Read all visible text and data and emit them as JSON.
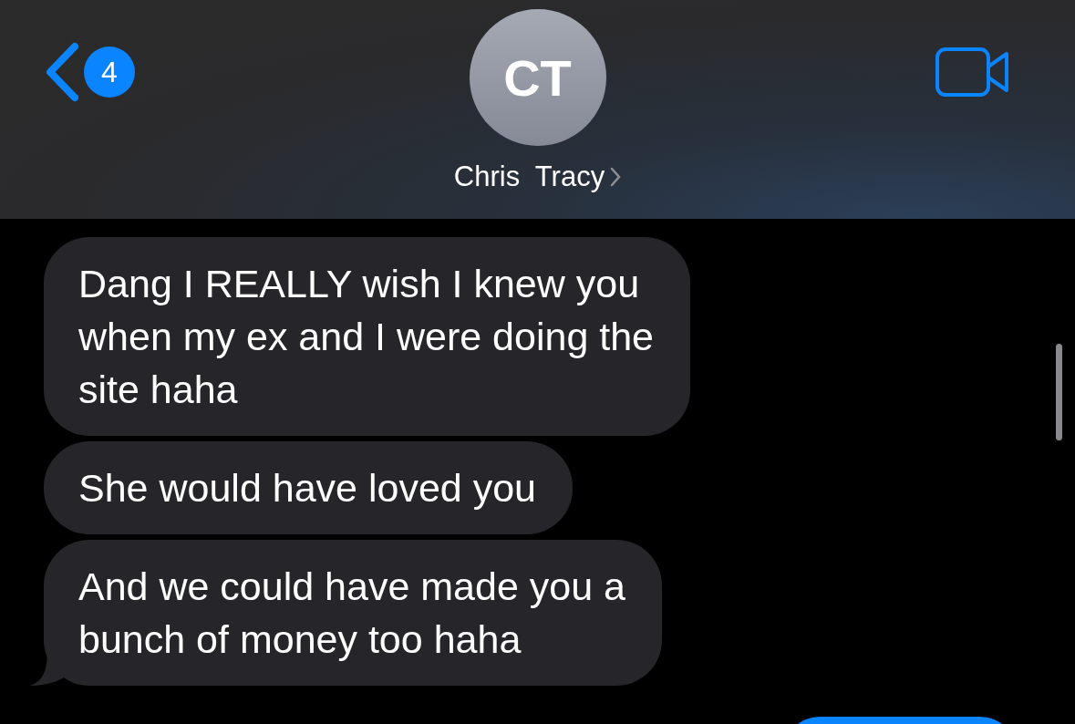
{
  "header": {
    "unread_count": "4",
    "avatar_initials": "CT",
    "contact_name": "Chris  Tracy"
  },
  "messages": [
    {
      "kind": "incoming",
      "text": "Dang I REALLY wish I knew you\nwhen my ex and I were doing the\nsite haha",
      "tail": false
    },
    {
      "kind": "incoming",
      "text": "She would have loved you",
      "tail": false
    },
    {
      "kind": "incoming",
      "text": "And we could have made you a\nbunch of money too haha",
      "tail": true
    },
    {
      "kind": "outgoing"
    }
  ]
}
